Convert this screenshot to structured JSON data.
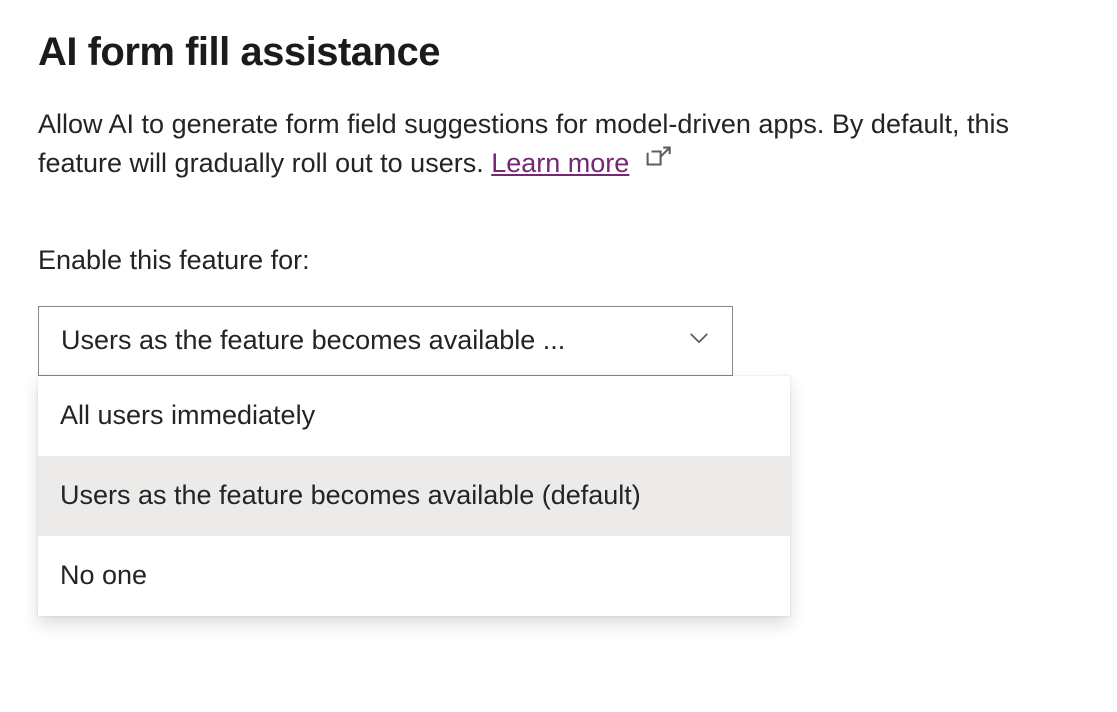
{
  "section": {
    "title": "AI form fill assistance",
    "description_part1": "Allow AI to generate form field suggestions for model-driven apps. By default, this feature will gradually roll out to users. ",
    "learn_more_label": "Learn more"
  },
  "field": {
    "label": "Enable this feature for:",
    "selected_display": "Users as the feature becomes available ...",
    "options": [
      {
        "label": "All users immediately",
        "selected": false
      },
      {
        "label": "Users as the feature becomes available (default)",
        "selected": true
      },
      {
        "label": "No one",
        "selected": false
      }
    ]
  },
  "colors": {
    "link": "#742774",
    "border": "#8a8886",
    "selected_bg": "#edebe9"
  }
}
